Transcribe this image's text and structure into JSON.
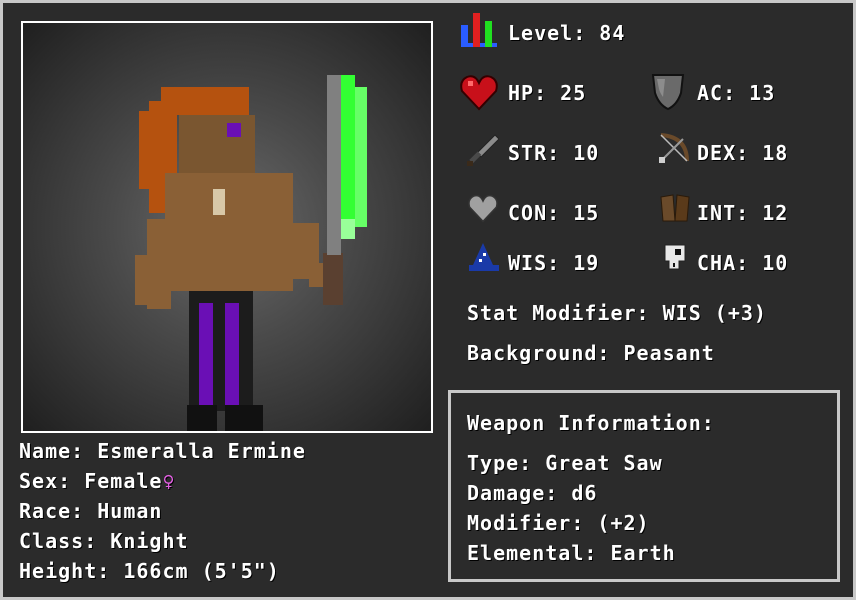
{
  "character": {
    "name_label": "Name:",
    "name": "Esmeralla Ermine",
    "sex_label": "Sex:",
    "sex": "Female",
    "sex_symbol": "♀",
    "race_label": "Race:",
    "race": "Human",
    "class_label": "Class:",
    "class": "Knight",
    "height_label": "Height:",
    "height": "166cm (5'5\")"
  },
  "stats": {
    "level_label": "Level:",
    "level": "84",
    "hp_label": "HP:",
    "hp": "25",
    "ac_label": "AC:",
    "ac": "13",
    "str_label": "STR:",
    "str": "10",
    "dex_label": "DEX:",
    "dex": "18",
    "con_label": "CON:",
    "con": "15",
    "int_label": "INT:",
    "int": "12",
    "wis_label": "WIS:",
    "wis": "19",
    "cha_label": "CHA:",
    "cha": "10",
    "modifier_label": "Stat Modifier:",
    "modifier": "WIS (+3)",
    "background_label": "Background:",
    "background": "Peasant"
  },
  "weapon": {
    "heading": "Weapon Information:",
    "type_label": "Type:",
    "type": "Great Saw",
    "damage_label": "Damage:",
    "damage": "d6",
    "modifier_label": "Modifier:",
    "modifier": "(+2)",
    "elemental_label": "Elemental:",
    "elemental": "Earth"
  },
  "icons": {
    "level": "level-bars-icon",
    "hp": "heart-icon",
    "ac": "shield-icon",
    "str": "sword-icon",
    "dex": "bow-icon",
    "con": "grey-heart-icon",
    "int": "book-icon",
    "wis": "wizard-hat-icon",
    "cha": "skull-icon"
  },
  "colors": {
    "background": "#2b2b2b",
    "frame": "#c8c8c8",
    "text": "#ffffff",
    "hair": "#b5520f",
    "skin": "#8a6036",
    "pants": "#6a0fb5",
    "saw_glow": "#33ff33",
    "sex_symbol": "#e060e0"
  }
}
